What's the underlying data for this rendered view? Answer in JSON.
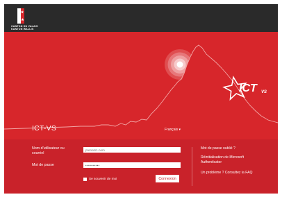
{
  "logo": {
    "line1": "CANTON DU VALAIS",
    "line2": "KANTON WALLIS",
    "icon": "valais-flag-icon"
  },
  "hero": {
    "site_title": "ICT-VS",
    "brand": "ICT",
    "brand_suffix": "VS",
    "language": "Français ▾"
  },
  "form": {
    "username_label": "Nom d'utilisateur ou courriel",
    "username_placeholder": "prenom1.nom",
    "password_label": "Mot de passe",
    "password_value": "••••••••••",
    "remember_label": "Se souvenir de moi",
    "submit_label": "Connexion"
  },
  "links": {
    "forgot_password": "Mot de passe oublié ?",
    "reset_authenticator": "Réinitialisation de Microsoft Authenticator",
    "faq": "Un problème ? Consultez la FAQ"
  },
  "colors": {
    "topbar": "#2a2a2a",
    "hero": "#d7262b",
    "form": "#c9222a",
    "text": "#ffffff"
  }
}
